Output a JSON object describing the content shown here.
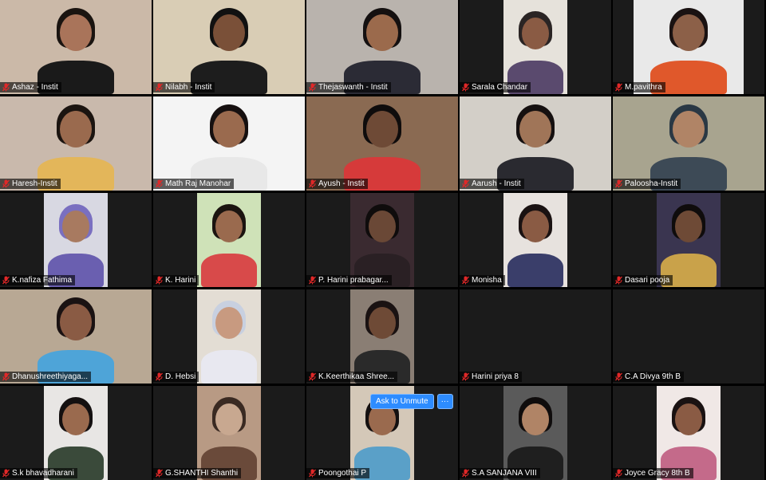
{
  "meeting": {
    "participants": [
      {
        "name": "Ashaz - Instit",
        "muted": true,
        "video": "full",
        "bg": "#cbb9a8",
        "skin": "#a9745a",
        "shirt": "#1a1a1a",
        "hair": "#1a1410"
      },
      {
        "name": "Nilabh - Instit",
        "muted": true,
        "video": "full",
        "bg": "#d9cdb5",
        "skin": "#7a5038",
        "shirt": "#1d1d1d",
        "hair": "#111111",
        "speaking": true
      },
      {
        "name": "Thejaswanth - Instit",
        "muted": true,
        "video": "full",
        "bg": "#b9b3ad",
        "skin": "#9b6a4c",
        "shirt": "#2b2b35",
        "hair": "#141010"
      },
      {
        "name": "Sarala Chandar",
        "muted": true,
        "video": "center",
        "bg": "#e6e2db",
        "skin": "#8a5b44",
        "shirt": "#5a4a6e",
        "hair": "#2a2424"
      },
      {
        "name": "M.pavithra",
        "muted": true,
        "video": "center-wide",
        "bg": "#e9e9e9",
        "skin": "#8c6048",
        "shirt": "#e0582b",
        "hair": "#1a1212"
      },
      {
        "name": "Haresh-Instit",
        "muted": true,
        "video": "full",
        "bg": "#c9b9ac",
        "skin": "#9a6a4e",
        "shirt": "#e3b65a",
        "hair": "#1b1410"
      },
      {
        "name": "Math Raj Manohar",
        "muted": true,
        "video": "full",
        "bg": "#f4f4f4",
        "skin": "#9a6a4e",
        "shirt": "#e8e8e8",
        "hair": "#161010"
      },
      {
        "name": "Ayush - Instit",
        "muted": true,
        "video": "full",
        "bg": "#8a6a52",
        "skin": "#6e4a36",
        "shirt": "#d63a3a",
        "hair": "#0f0c0c"
      },
      {
        "name": "Aarush - Instit",
        "muted": true,
        "video": "full",
        "bg": "#d3cfc8",
        "skin": "#a07558",
        "shirt": "#2a2a30",
        "hair": "#151010"
      },
      {
        "name": "Paloosha-Instit",
        "muted": true,
        "video": "full",
        "bg": "#a8a48f",
        "skin": "#b08466",
        "shirt": "#3d4a56",
        "hair": "#2a3844"
      },
      {
        "name": "K.nafiza Fathima",
        "muted": true,
        "video": "center",
        "bg": "#d8d8e2",
        "skin": "#a87a60",
        "shirt": "#6a5fb0",
        "hair": "#7a6fc0"
      },
      {
        "name": "K. Harini",
        "muted": true,
        "video": "center",
        "bg": "#cfe2b8",
        "skin": "#9a6a4e",
        "shirt": "#d84a4a",
        "hair": "#1b1410"
      },
      {
        "name": "P. Harini prabagar...",
        "muted": true,
        "video": "center",
        "bg": "#3a2a30",
        "skin": "#6a4836",
        "shirt": "#2a2024",
        "hair": "#0f0c0c"
      },
      {
        "name": "Monisha",
        "muted": true,
        "video": "center",
        "bg": "#e7e2de",
        "skin": "#8a5b44",
        "shirt": "#3a3e6a",
        "hair": "#1a1212"
      },
      {
        "name": "Dasari pooja",
        "muted": true,
        "video": "center",
        "bg": "#3a3550",
        "skin": "#6e4a36",
        "shirt": "#c9a24a",
        "hair": "#0f0c0c"
      },
      {
        "name": "Dhanushreethiyaga...",
        "muted": true,
        "video": "full",
        "bg": "#b8a894",
        "skin": "#8a5b44",
        "shirt": "#4ea4d8",
        "hair": "#1a1212"
      },
      {
        "name": "D. Hebsi",
        "muted": true,
        "video": "center",
        "bg": "#e3ddd4",
        "skin": "#c89a80",
        "shirt": "#e8e8f0",
        "hair": "#c8d0e0"
      },
      {
        "name": "K.Keerthikaa Shree...",
        "muted": true,
        "video": "center",
        "bg": "#8a7e74",
        "skin": "#6e4a36",
        "shirt": "#2a2a2a",
        "hair": "#1a1212"
      },
      {
        "name": "Harini priya 8",
        "muted": true,
        "video": "none"
      },
      {
        "name": "C.A Divya 9th B",
        "muted": true,
        "video": "none"
      },
      {
        "name": "S.k bhavadharani",
        "muted": true,
        "video": "center",
        "bg": "#e8e6e4",
        "skin": "#9a6a4e",
        "shirt": "#3a4a3a",
        "hair": "#141010"
      },
      {
        "name": "G.SHANTHI Shanthi",
        "muted": true,
        "video": "center",
        "bg": "#b89a84",
        "skin": "#c8a890",
        "shirt": "#6a4a3a",
        "hair": "#3a2a22"
      },
      {
        "name": "Poongothai P",
        "muted": true,
        "video": "center",
        "bg": "#d4c8b8",
        "skin": "#9a6a4e",
        "shirt": "#5aa0c8",
        "hair": "#141010"
      },
      {
        "name": "S.A SANJANA VIII",
        "muted": true,
        "video": "center",
        "bg": "#5a5a5a",
        "skin": "#b08466",
        "shirt": "#1f1f1f",
        "hair": "#0f0c0c"
      },
      {
        "name": "Joyce Gracy 8th B",
        "muted": true,
        "video": "center",
        "bg": "#f0e8e6",
        "skin": "#8a5b44",
        "shirt": "#c46a8a",
        "hair": "#1a1212"
      }
    ]
  },
  "popup": {
    "unmute_label": "Ask to Unmute",
    "more_label": "···"
  },
  "colors": {
    "speaking_border": "#c6e13b",
    "muted_icon": "#e02828",
    "button_blue": "#2d8cff"
  }
}
